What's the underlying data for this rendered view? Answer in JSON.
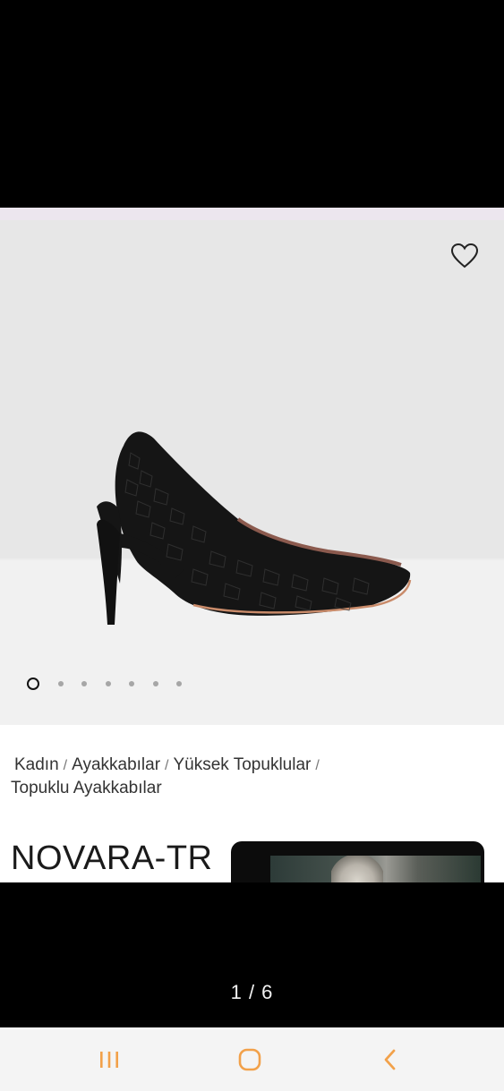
{
  "product": {
    "name": "NOVARA-TR",
    "images_count": 7,
    "active_image_index": 0
  },
  "breadcrumb": {
    "items": [
      "Kadın",
      "Ayakkabılar",
      "Yüksek Topuklular",
      "Topuklu Ayakkabılar"
    ],
    "separator": "/"
  },
  "viewer": {
    "counter": "1 / 6"
  },
  "icons": {
    "favorite": "heart-outline-icon",
    "recents": "recent-apps-icon",
    "home": "home-icon",
    "back": "back-icon"
  },
  "colors": {
    "nav_accent": "#f2a14a",
    "text": "#333333",
    "hero_bg": "#e7e7e7"
  }
}
